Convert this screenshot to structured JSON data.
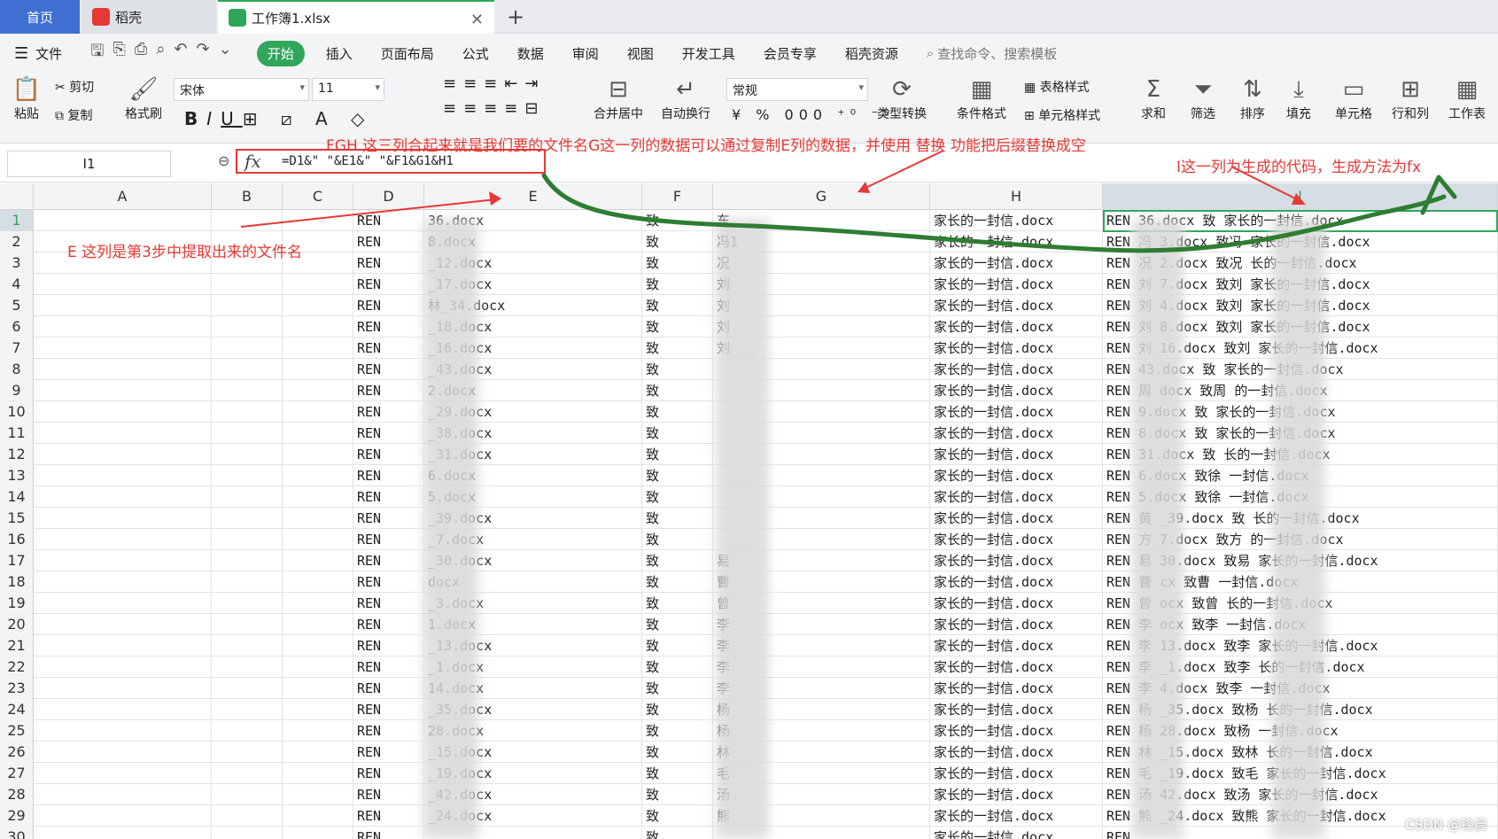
{
  "tabs": {
    "home": "首页",
    "daoke": "稻壳",
    "workbook": "工作簿1.xlsx"
  },
  "menu": {
    "file": "文件",
    "items": [
      "开始",
      "插入",
      "页面布局",
      "公式",
      "数据",
      "审阅",
      "视图",
      "开发工具",
      "会员专享",
      "稻壳资源"
    ],
    "search_placeholder": "查找命令、搜索模板"
  },
  "ribbon": {
    "paste": "粘贴",
    "cut": "剪切",
    "copy": "复制",
    "format_painter": "格式刷",
    "font": "宋体",
    "size": "11",
    "merge": "合并居中",
    "wrap": "自动换行",
    "number_format": "常规",
    "type_convert": "类型转换",
    "cond_format": "条件格式",
    "table_style": "表格样式",
    "cell_style": "单元格样式",
    "sum": "求和",
    "filter": "筛选",
    "sort": "排序",
    "fill": "填充",
    "cell": "单元格",
    "rowcol": "行和列",
    "sheet": "工作表"
  },
  "formula_bar": {
    "name_box": "I1",
    "fx": "fx",
    "formula": "=D1&\" \"&E1&\" \"&F1&G1&H1"
  },
  "columns": [
    "A",
    "B",
    "C",
    "D",
    "E",
    "F",
    "G",
    "H",
    "I"
  ],
  "annotations": {
    "fgh": "FGH 这三列合起来就是我们要的文件名G这一列的数据可以通过复制E列的数据，并使用 替换 功能把后缀替换成空",
    "e_col": "E 这列是第3步中提取出来的文件名",
    "i_col": "I这一列为生成的代码，生成方法为fx"
  },
  "rows": [
    {
      "n": "1",
      "d": "REN",
      "e": "36.docx",
      "f": "致",
      "g": "东",
      "h": "家长的一封信.docx",
      "i": "REN    36.docx 致   家长的一封信.docx"
    },
    {
      "n": "2",
      "d": "REN",
      "e": "8.docx",
      "f": "致",
      "g": "冯1",
      "h": "家长的一封信.docx",
      "i": "REN 冯  3.docx 致冯   家长的一封信.docx"
    },
    {
      "n": "3",
      "d": "REN",
      "e": "_12.docx",
      "f": "致",
      "g": "况",
      "h": "家长的一封信.docx",
      "i": "REN 况   2.docx 致况   长的一封信.docx"
    },
    {
      "n": "4",
      "d": "REN",
      "e": "_17.docx",
      "f": "致",
      "g": "刘",
      "h": "家长的一封信.docx",
      "i": "REN 刘   7.docx 致刘   家长的一封信.docx"
    },
    {
      "n": "5",
      "d": "REN",
      "e": "林_34.docx",
      "f": "致",
      "g": "刘",
      "h": "家长的一封信.docx",
      "i": "REN 刘   4.docx 致刘   家长的一封信.docx"
    },
    {
      "n": "6",
      "d": "REN",
      "e": "_18.docx",
      "f": "致",
      "g": "刘",
      "h": "家长的一封信.docx",
      "i": "REN 刘   8.docx 致刘   家长的一封信.docx"
    },
    {
      "n": "7",
      "d": "REN",
      "e": "_16.docx",
      "f": "致",
      "g": "刘",
      "h": "家长的一封信.docx",
      "i": "REN 刘  16.docx 致刘   家长的一封信.docx"
    },
    {
      "n": "8",
      "d": "REN",
      "e": "_43.docx",
      "f": "致",
      "g": "",
      "h": "家长的一封信.docx",
      "i": "REN    43.docx 致    家长的一封信.docx"
    },
    {
      "n": "9",
      "d": "REN",
      "e": "2.docx",
      "f": "致",
      "g": "",
      "h": "家长的一封信.docx",
      "i": "REN 周   docx 致周   的一封信.docx"
    },
    {
      "n": "10",
      "d": "REN",
      "e": "_29.docx",
      "f": "致",
      "g": "",
      "h": "家长的一封信.docx",
      "i": "REN    9.docx 致    家长的一封信.docx"
    },
    {
      "n": "11",
      "d": "REN",
      "e": "_38.docx",
      "f": "致",
      "g": "",
      "h": "家长的一封信.docx",
      "i": "REN    8.docx 致    家长的一封信.docx"
    },
    {
      "n": "12",
      "d": "REN",
      "e": "_31.docx",
      "f": "致",
      "g": "",
      "h": "家长的一封信.docx",
      "i": "REN    31.docx 致    长的一封信.docx"
    },
    {
      "n": "13",
      "d": "REN",
      "e": "6.docx",
      "f": "致",
      "g": "",
      "h": "家长的一封信.docx",
      "i": "REN    6.docx 致徐   一封信.docx"
    },
    {
      "n": "14",
      "d": "REN",
      "e": "5.docx",
      "f": "致",
      "g": "",
      "h": "家长的一封信.docx",
      "i": "REN    5.docx 致徐   一封信.docx"
    },
    {
      "n": "15",
      "d": "REN",
      "e": "_39.docx",
      "f": "致",
      "g": "",
      "h": "家长的一封信.docx",
      "i": "REN 黄  _39.docx 致   长的一封信.docx"
    },
    {
      "n": "16",
      "d": "REN",
      "e": "_7.docx",
      "f": "致",
      "g": "",
      "h": "家长的一封信.docx",
      "i": "REN 方   7.docx 致方   的一封信.docx"
    },
    {
      "n": "17",
      "d": "REN",
      "e": "_30.docx",
      "f": "致",
      "g": "易",
      "h": "家长的一封信.docx",
      "i": "REN 易  30.docx 致易   家长的一封信.docx"
    },
    {
      "n": "18",
      "d": "REN",
      "e": "docx",
      "f": "致",
      "g": "曹",
      "h": "家长的一封信.docx",
      "i": "REN 曹   cx 致曹   一封信.docx"
    },
    {
      "n": "19",
      "d": "REN",
      "e": "_3.docx",
      "f": "致",
      "g": "曾",
      "h": "家长的一封信.docx",
      "i": "REN 曾   ocx 致曾   长的一封信.docx"
    },
    {
      "n": "20",
      "d": "REN",
      "e": "1.docx",
      "f": "致",
      "g": "李",
      "h": "家长的一封信.docx",
      "i": "REN 李   ocx 致李   一封信.docx"
    },
    {
      "n": "21",
      "d": "REN",
      "e": "_13.docx",
      "f": "致",
      "g": "李",
      "h": "家长的一封信.docx",
      "i": "REN 李  13.docx 致李   家长的一封信.docx"
    },
    {
      "n": "22",
      "d": "REN",
      "e": "_1.docx",
      "f": "致",
      "g": "李",
      "h": "家长的一封信.docx",
      "i": "REN 李   _1.docx 致李   长的一封信.docx"
    },
    {
      "n": "23",
      "d": "REN",
      "e": "14.docx",
      "f": "致",
      "g": "李",
      "h": "家长的一封信.docx",
      "i": "REN 李   4.docx 致李   一封信.docx"
    },
    {
      "n": "24",
      "d": "REN",
      "e": "_35.docx",
      "f": "致",
      "g": "杨",
      "h": "家长的一封信.docx",
      "i": "REN 杨  _35.docx 致杨   长的一封信.docx"
    },
    {
      "n": "25",
      "d": "REN",
      "e": "28.docx",
      "f": "致",
      "g": "杨",
      "h": "家长的一封信.docx",
      "i": "REN 杨  28.docx 致杨   一封信.docx"
    },
    {
      "n": "26",
      "d": "REN",
      "e": "_15.docx",
      "f": "致",
      "g": "林",
      "h": "家长的一封信.docx",
      "i": "REN 林  _15.docx 致林   长的一封信.docx"
    },
    {
      "n": "27",
      "d": "REN",
      "e": "_19.docx",
      "f": "致",
      "g": "毛",
      "h": "家长的一封信.docx",
      "i": "REN 毛  _19.docx 致毛   家长的一封信.docx"
    },
    {
      "n": "28",
      "d": "REN",
      "e": "_42.docx",
      "f": "致",
      "g": "汤",
      "h": "家长的一封信.docx",
      "i": "REN 汤  42.docx 致汤   家长的一封信.docx"
    },
    {
      "n": "29",
      "d": "REN",
      "e": "_24.docx",
      "f": "致",
      "g": "熊",
      "h": "家长的一封信.docx",
      "i": "REN 熊  _24.docx 致熊   家长的一封信.docx"
    },
    {
      "n": "30",
      "d": "REN",
      "e": "",
      "f": "致",
      "g": "",
      "h": "家长的一封信.docx",
      "i": "REN"
    }
  ],
  "watermark": "CSDN @锋晨",
  "colors": {
    "accent": "#2fa65a",
    "annotation": "#e53935",
    "arrow_green": "#2e7d32",
    "tab_home": "#3f6fd0"
  }
}
